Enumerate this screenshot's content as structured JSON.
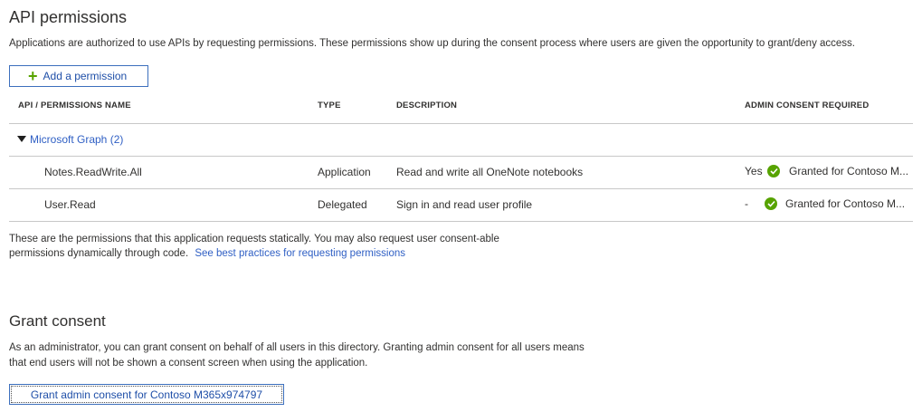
{
  "header": {
    "title": "API permissions",
    "description": "Applications are authorized to use APIs by requesting permissions. These permissions show up during the consent process where users are given the opportunity to grant/deny access.",
    "add_permission_label": "Add a permission"
  },
  "table": {
    "columns": [
      "API / PERMISSIONS NAME",
      "TYPE",
      "DESCRIPTION",
      "ADMIN CONSENT REQUIRED"
    ],
    "group": {
      "label": "Microsoft Graph (2)"
    },
    "rows": [
      {
        "name": "Notes.ReadWrite.All",
        "type": "Application",
        "description": "Read and write all OneNote notebooks",
        "admin_required": "Yes",
        "consent_status": "Granted for Contoso M..."
      },
      {
        "name": "User.Read",
        "type": "Delegated",
        "description": "Sign in and read user profile",
        "admin_required": "-",
        "consent_status": "Granted for Contoso M..."
      }
    ]
  },
  "footnote": {
    "line1": "These are the permissions that this application requests statically. You may also request user consent-able",
    "line2": "permissions dynamically through code.",
    "link": "See best practices for requesting permissions"
  },
  "grant": {
    "title": "Grant consent",
    "line1": "As an administrator, you can grant consent on behalf of all users in this directory. Granting admin consent for all users means",
    "line2": "that end users will not be shown a consent screen when using the application.",
    "button_label": "Grant admin consent for Contoso M365x974797"
  },
  "colors": {
    "accent": "#2f5fc4",
    "success": "#57a300",
    "border": "#c8c8c8"
  }
}
